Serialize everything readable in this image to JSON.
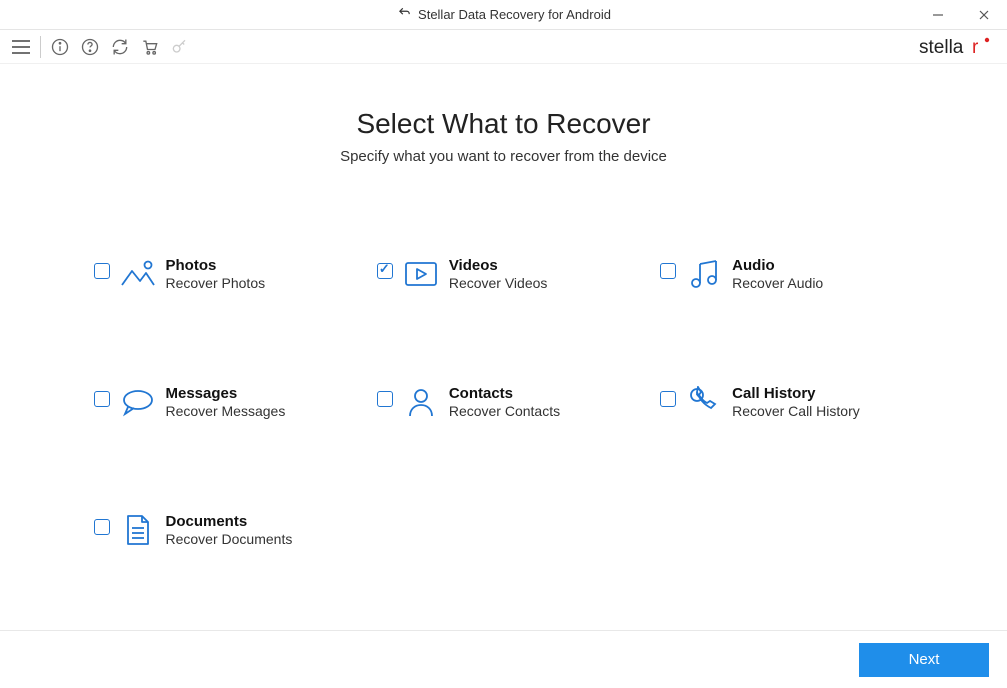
{
  "window": {
    "title": "Stellar Data Recovery for Android"
  },
  "brand": {
    "name": "stellar"
  },
  "main": {
    "heading": "Select What to Recover",
    "subheading": "Specify what you want to recover from the device"
  },
  "options": {
    "photos": {
      "title": "Photos",
      "sub": "Recover Photos",
      "checked": false
    },
    "videos": {
      "title": "Videos",
      "sub": "Recover Videos",
      "checked": true
    },
    "audio": {
      "title": "Audio",
      "sub": "Recover Audio",
      "checked": false
    },
    "messages": {
      "title": "Messages",
      "sub": "Recover Messages",
      "checked": false
    },
    "contacts": {
      "title": "Contacts",
      "sub": "Recover Contacts",
      "checked": false
    },
    "callhistory": {
      "title": "Call History",
      "sub": "Recover Call History",
      "checked": false
    },
    "documents": {
      "title": "Documents",
      "sub": "Recover Documents",
      "checked": false
    }
  },
  "footer": {
    "next": "Next"
  }
}
